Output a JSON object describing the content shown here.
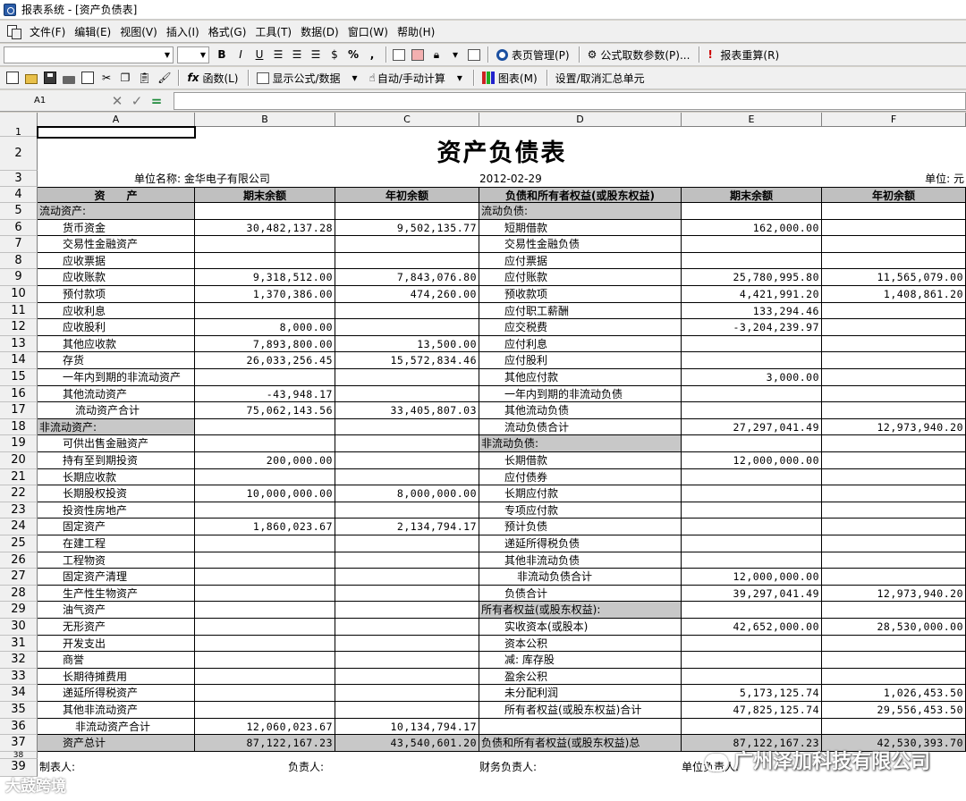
{
  "window": {
    "title": "报表系统 - [资产负债表]"
  },
  "menu": [
    "文件(F)",
    "编辑(E)",
    "视图(V)",
    "插入(I)",
    "格式(G)",
    "工具(T)",
    "数据(D)",
    "窗口(W)",
    "帮助(H)"
  ],
  "toolbar1": {
    "bold": "B",
    "italic": "I",
    "underline": "U",
    "percent": "%",
    "comma": ",",
    "page_mgmt": "表页管理(P)",
    "formula_params": "公式取数参数(P)...",
    "recalc": "报表重算(R)"
  },
  "toolbar2": {
    "function": "函数(L)",
    "show_formula": "显示公式/数据",
    "auto_calc": "自动/手动计算",
    "chart": "图表(M)",
    "set_summary": "设置/取消汇总单元"
  },
  "formula_bar": {
    "cell_ref": "A1",
    "cancel": "✕",
    "confirm": "✓",
    "equals": "="
  },
  "columns": [
    "A",
    "B",
    "C",
    "D",
    "E",
    "F"
  ],
  "sheet": {
    "title": "资产负债表",
    "unit_name": "单位名称: 金华电子有限公司",
    "date": "2012-02-29",
    "unit": "单位: 元",
    "headers": [
      "资　　产",
      "期末余额",
      "年初余额",
      "负债和所有者权益(或股东权益)",
      "期末余额",
      "年初余额"
    ],
    "rows": [
      {
        "r": "5",
        "a": "流动资产:",
        "b": "",
        "c": "",
        "d": "流动负债:",
        "e": "",
        "f": ""
      },
      {
        "r": "6",
        "a": "货币资金",
        "b": "30,482,137.28",
        "c": "9,502,135.77",
        "d": "短期借款",
        "e": "162,000.00",
        "f": ""
      },
      {
        "r": "7",
        "a": "交易性金融资产",
        "b": "",
        "c": "",
        "d": "交易性金融负债",
        "e": "",
        "f": ""
      },
      {
        "r": "8",
        "a": "应收票据",
        "b": "",
        "c": "",
        "d": "应付票据",
        "e": "",
        "f": ""
      },
      {
        "r": "9",
        "a": "应收账款",
        "b": "9,318,512.00",
        "c": "7,843,076.80",
        "d": "应付账款",
        "e": "25,780,995.80",
        "f": "11,565,079.00"
      },
      {
        "r": "10",
        "a": "预付款项",
        "b": "1,370,386.00",
        "c": "474,260.00",
        "d": "预收款项",
        "e": "4,421,991.20",
        "f": "1,408,861.20"
      },
      {
        "r": "11",
        "a": "应收利息",
        "b": "",
        "c": "",
        "d": "应付职工薪酬",
        "e": "133,294.46",
        "f": ""
      },
      {
        "r": "12",
        "a": "应收股利",
        "b": "8,000.00",
        "c": "",
        "d": "应交税费",
        "e": "-3,204,239.97",
        "f": ""
      },
      {
        "r": "13",
        "a": "其他应收款",
        "b": "7,893,800.00",
        "c": "13,500.00",
        "d": "应付利息",
        "e": "",
        "f": ""
      },
      {
        "r": "14",
        "a": "存货",
        "b": "26,033,256.45",
        "c": "15,572,834.46",
        "d": "应付股利",
        "e": "",
        "f": ""
      },
      {
        "r": "15",
        "a": "一年内到期的非流动资产",
        "b": "",
        "c": "",
        "d": "其他应付款",
        "e": "3,000.00",
        "f": ""
      },
      {
        "r": "16",
        "a": "其他流动资产",
        "b": "-43,948.17",
        "c": "",
        "d": "一年内到期的非流动负债",
        "e": "",
        "f": ""
      },
      {
        "r": "17",
        "a": "流动资产合计",
        "b": "75,062,143.56",
        "c": "33,405,807.03",
        "d": "其他流动负债",
        "e": "",
        "f": ""
      },
      {
        "r": "18",
        "a": "非流动资产:",
        "b": "",
        "c": "",
        "d": "流动负债合计",
        "e": "27,297,041.49",
        "f": "12,973,940.20"
      },
      {
        "r": "19",
        "a": "可供出售金融资产",
        "b": "",
        "c": "",
        "d": "非流动负债:",
        "e": "",
        "f": ""
      },
      {
        "r": "20",
        "a": "持有至到期投资",
        "b": "200,000.00",
        "c": "",
        "d": "长期借款",
        "e": "12,000,000.00",
        "f": ""
      },
      {
        "r": "21",
        "a": "长期应收款",
        "b": "",
        "c": "",
        "d": "应付债券",
        "e": "",
        "f": ""
      },
      {
        "r": "22",
        "a": "长期股权投资",
        "b": "10,000,000.00",
        "c": "8,000,000.00",
        "d": "长期应付款",
        "e": "",
        "f": ""
      },
      {
        "r": "23",
        "a": "投资性房地产",
        "b": "",
        "c": "",
        "d": "专项应付款",
        "e": "",
        "f": ""
      },
      {
        "r": "24",
        "a": "固定资产",
        "b": "1,860,023.67",
        "c": "2,134,794.17",
        "d": "预计负债",
        "e": "",
        "f": ""
      },
      {
        "r": "25",
        "a": "在建工程",
        "b": "",
        "c": "",
        "d": "递延所得税负债",
        "e": "",
        "f": ""
      },
      {
        "r": "26",
        "a": "工程物资",
        "b": "",
        "c": "",
        "d": "其他非流动负债",
        "e": "",
        "f": ""
      },
      {
        "r": "27",
        "a": "固定资产清理",
        "b": "",
        "c": "",
        "d": "非流动负债合计",
        "e": "12,000,000.00",
        "f": ""
      },
      {
        "r": "28",
        "a": "生产性生物资产",
        "b": "",
        "c": "",
        "d": "负债合计",
        "e": "39,297,041.49",
        "f": "12,973,940.20"
      },
      {
        "r": "29",
        "a": "油气资产",
        "b": "",
        "c": "",
        "d": "所有者权益(或股东权益):",
        "e": "",
        "f": ""
      },
      {
        "r": "30",
        "a": "无形资产",
        "b": "",
        "c": "",
        "d": "实收资本(或股本)",
        "e": "42,652,000.00",
        "f": "28,530,000.00"
      },
      {
        "r": "31",
        "a": "开发支出",
        "b": "",
        "c": "",
        "d": "资本公积",
        "e": "",
        "f": ""
      },
      {
        "r": "32",
        "a": "商誉",
        "b": "",
        "c": "",
        "d": "减: 库存股",
        "e": "",
        "f": ""
      },
      {
        "r": "33",
        "a": "长期待摊费用",
        "b": "",
        "c": "",
        "d": "盈余公积",
        "e": "",
        "f": ""
      },
      {
        "r": "34",
        "a": "递延所得税资产",
        "b": "",
        "c": "",
        "d": "未分配利润",
        "e": "5,173,125.74",
        "f": "1,026,453.50"
      },
      {
        "r": "35",
        "a": "其他非流动资产",
        "b": "",
        "c": "",
        "d": "所有者权益(或股东权益)合计",
        "e": "47,825,125.74",
        "f": "29,556,453.50"
      },
      {
        "r": "36",
        "a": "非流动资产合计",
        "b": "12,060,023.67",
        "c": "10,134,794.17",
        "d": "",
        "e": "",
        "f": ""
      },
      {
        "r": "37",
        "a": "资产总计",
        "b": "87,122,167.23",
        "c": "43,540,601.20",
        "d": "负债和所有者权益(或股东权益)总",
        "e": "87,122,167.23",
        "f": "42,530,393.70"
      }
    ],
    "footer": {
      "prepared_by": "制表人:",
      "responsible": "负责人:",
      "finance_head": "财务负责人:",
      "unit_head": "单位负责人:"
    }
  },
  "watermark": {
    "company": "广州泽加科技有限公司",
    "brand": "大鼓跨境"
  }
}
